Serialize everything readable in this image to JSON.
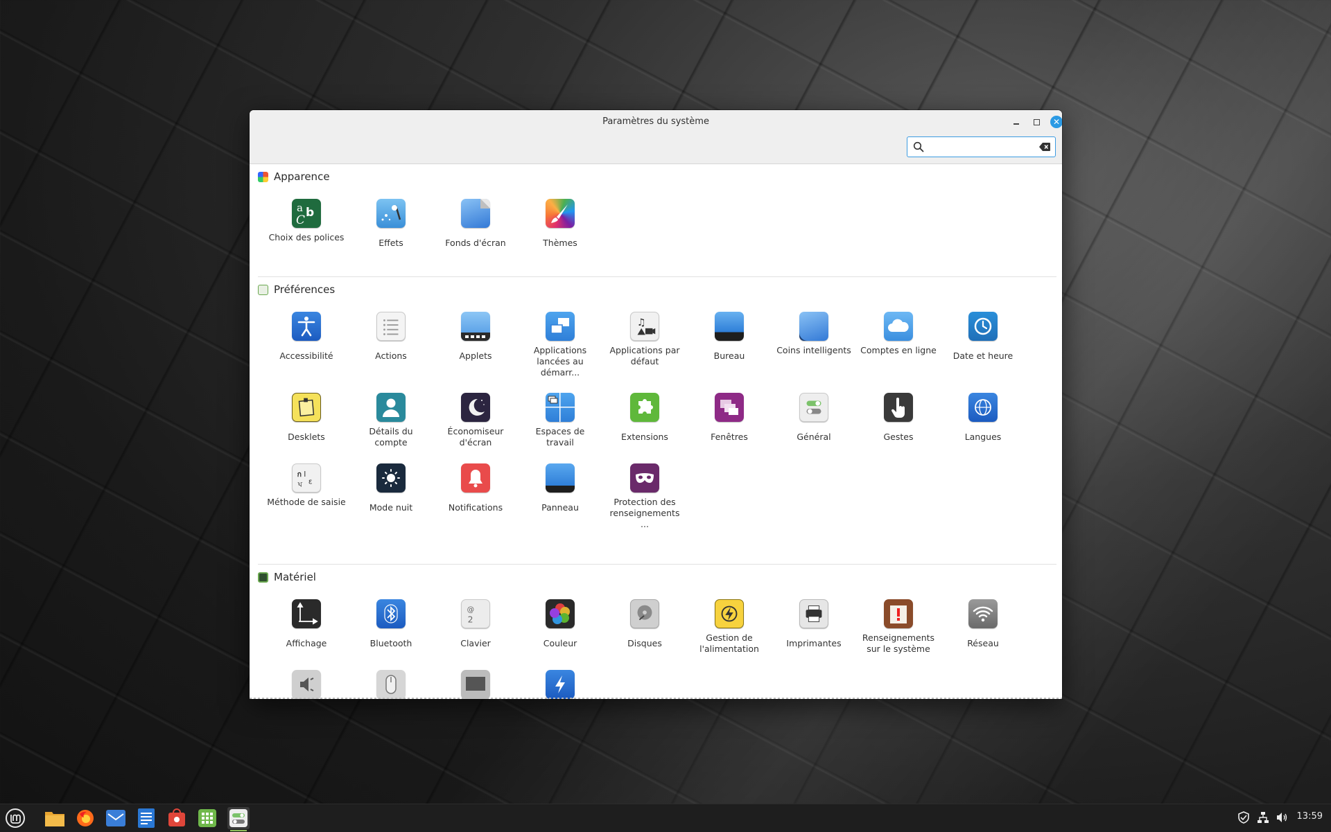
{
  "window": {
    "title": "Paramètres du système",
    "search_value": "",
    "search_placeholder": ""
  },
  "sections": [
    {
      "name": "Apparence",
      "items": [
        {
          "label": "Choix des polices"
        },
        {
          "label": "Effets"
        },
        {
          "label": "Fonds d'écran"
        },
        {
          "label": "Thèmes"
        }
      ]
    },
    {
      "name": "Préférences",
      "items": [
        {
          "label": "Accessibilité"
        },
        {
          "label": "Actions"
        },
        {
          "label": "Applets"
        },
        {
          "label": "Applications lancées au démarr..."
        },
        {
          "label": "Applications par défaut"
        },
        {
          "label": "Bureau"
        },
        {
          "label": "Coins intelligents"
        },
        {
          "label": "Comptes en ligne"
        },
        {
          "label": "Date et heure"
        },
        {
          "label": "Desklets"
        },
        {
          "label": "Détails du compte"
        },
        {
          "label": "Économiseur d'écran"
        },
        {
          "label": "Espaces de travail"
        },
        {
          "label": "Extensions"
        },
        {
          "label": "Fenêtres"
        },
        {
          "label": "Général"
        },
        {
          "label": "Gestes"
        },
        {
          "label": "Langues"
        },
        {
          "label": "Méthode de saisie"
        },
        {
          "label": "Mode nuit"
        },
        {
          "label": "Notifications"
        },
        {
          "label": "Panneau"
        },
        {
          "label": "Protection des renseignements ..."
        }
      ]
    },
    {
      "name": "Matériel",
      "items": [
        {
          "label": "Affichage"
        },
        {
          "label": "Bluetooth"
        },
        {
          "label": "Clavier"
        },
        {
          "label": "Couleur"
        },
        {
          "label": "Disques"
        },
        {
          "label": "Gestion de l'alimentation"
        },
        {
          "label": "Imprimantes"
        },
        {
          "label": "Renseignements sur le système"
        },
        {
          "label": "Réseau"
        }
      ]
    }
  ],
  "taskbar": {
    "clock": "13:59"
  }
}
